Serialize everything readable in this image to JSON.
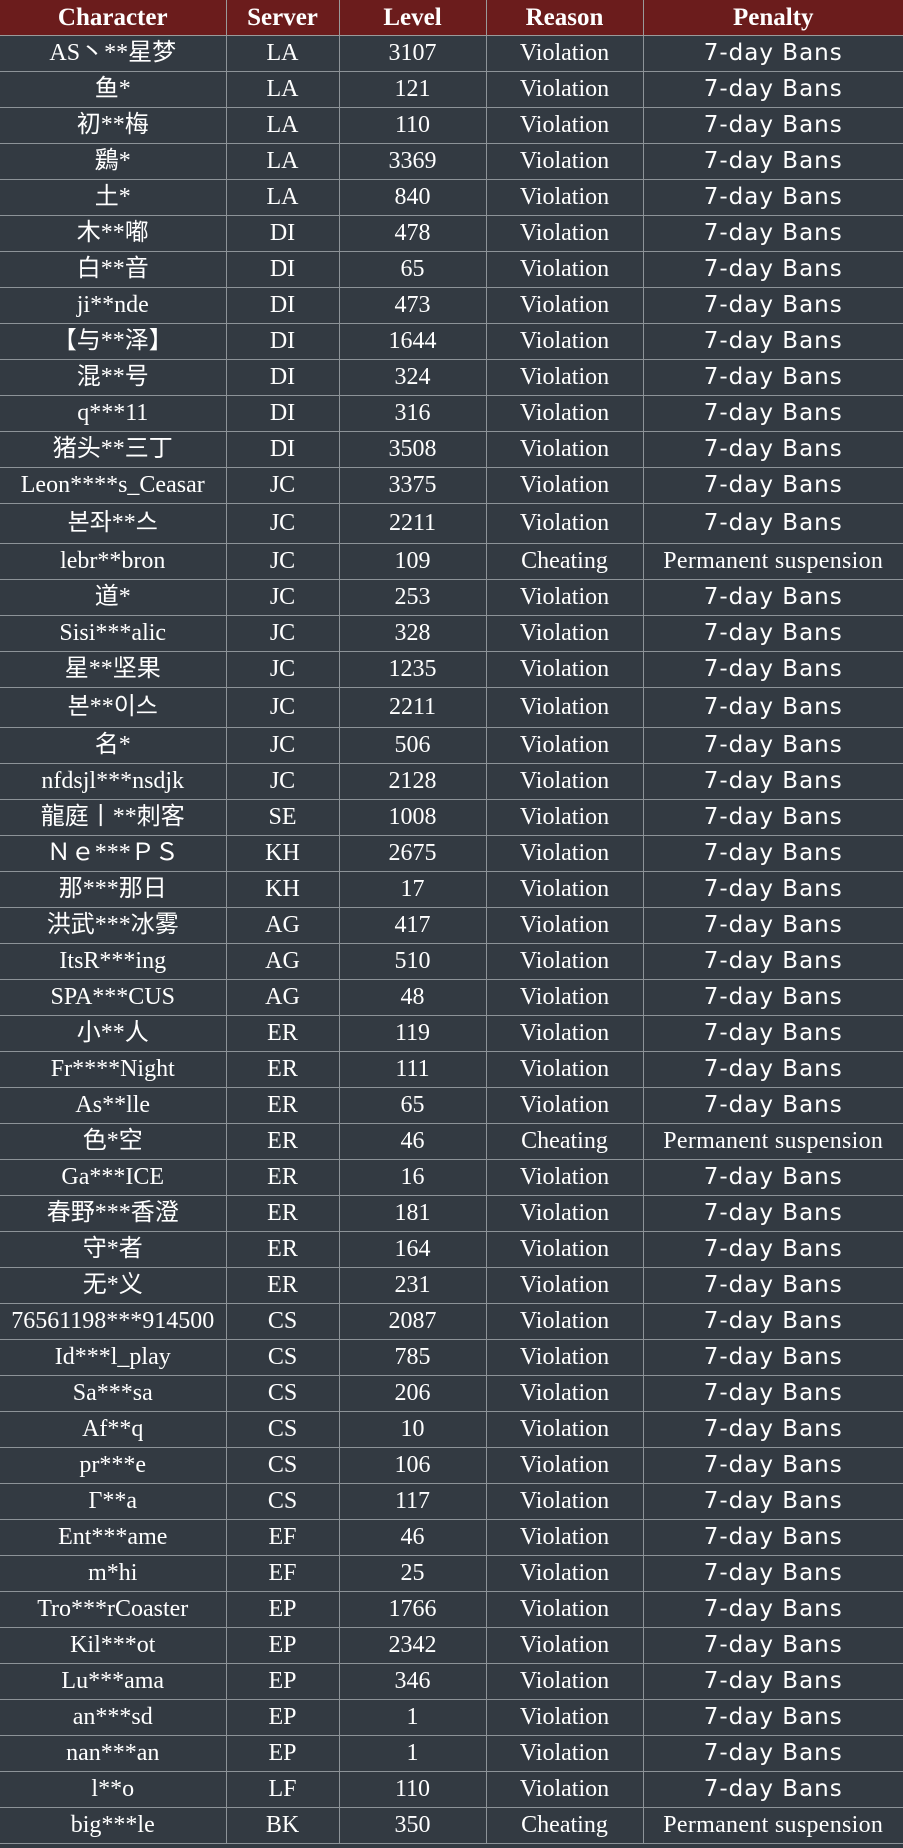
{
  "headers": {
    "character": "Character",
    "server": "Server",
    "level": "Level",
    "reason": "Reason",
    "penalty": "Penalty"
  },
  "rows": [
    {
      "character": "AS丶**星梦",
      "server": "LA",
      "level": "3107",
      "reason": "Violation",
      "penalty": "7-day Bans"
    },
    {
      "character": "鱼*",
      "server": "LA",
      "level": "121",
      "reason": "Violation",
      "penalty": "7-day Bans"
    },
    {
      "character": "初**梅",
      "server": "LA",
      "level": "110",
      "reason": "Violation",
      "penalty": "7-day Bans"
    },
    {
      "character": "鶢*",
      "server": "LA",
      "level": "3369",
      "reason": "Violation",
      "penalty": "7-day Bans"
    },
    {
      "character": "土*",
      "server": "LA",
      "level": "840",
      "reason": "Violation",
      "penalty": "7-day Bans"
    },
    {
      "character": "木**嘟",
      "server": "DI",
      "level": "478",
      "reason": "Violation",
      "penalty": "7-day Bans"
    },
    {
      "character": "白**音",
      "server": "DI",
      "level": "65",
      "reason": "Violation",
      "penalty": "7-day Bans"
    },
    {
      "character": "ji**nde",
      "server": "DI",
      "level": "473",
      "reason": "Violation",
      "penalty": "7-day Bans"
    },
    {
      "character": "【与**泽】",
      "server": "DI",
      "level": "1644",
      "reason": "Violation",
      "penalty": "7-day Bans"
    },
    {
      "character": "混**号",
      "server": "DI",
      "level": "324",
      "reason": "Violation",
      "penalty": "7-day Bans"
    },
    {
      "character": "q***11",
      "server": "DI",
      "level": "316",
      "reason": "Violation",
      "penalty": "7-day Bans"
    },
    {
      "character": "猪头**三丁",
      "server": "DI",
      "level": "3508",
      "reason": "Violation",
      "penalty": "7-day Bans"
    },
    {
      "character": "Leon****s_Ceasar",
      "server": "JC",
      "level": "3375",
      "reason": "Violation",
      "penalty": "7-day Bans"
    },
    {
      "character": "본좌**스",
      "server": "JC",
      "level": "2211",
      "reason": "Violation",
      "penalty": "7-day Bans"
    },
    {
      "character": "lebr**bron",
      "server": "JC",
      "level": "109",
      "reason": "Cheating",
      "penalty": "Permanent suspension"
    },
    {
      "character": "道*",
      "server": "JC",
      "level": "253",
      "reason": "Violation",
      "penalty": "7-day Bans"
    },
    {
      "character": "Sisi***alic",
      "server": "JC",
      "level": "328",
      "reason": "Violation",
      "penalty": "7-day Bans"
    },
    {
      "character": "星**坚果",
      "server": "JC",
      "level": "1235",
      "reason": "Violation",
      "penalty": "7-day Bans"
    },
    {
      "character": "본**이스",
      "server": "JC",
      "level": "2211",
      "reason": "Violation",
      "penalty": "7-day Bans"
    },
    {
      "character": "名*",
      "server": "JC",
      "level": "506",
      "reason": "Violation",
      "penalty": "7-day Bans"
    },
    {
      "character": "nfdsjl***nsdjk",
      "server": "JC",
      "level": "2128",
      "reason": "Violation",
      "penalty": "7-day Bans"
    },
    {
      "character": "龍庭丨**刺客",
      "server": "SE",
      "level": "1008",
      "reason": "Violation",
      "penalty": "7-day Bans"
    },
    {
      "character": "Ｎｅ***ＰＳ",
      "server": "KH",
      "level": "2675",
      "reason": "Violation",
      "penalty": "7-day Bans"
    },
    {
      "character": "那***那日",
      "server": "KH",
      "level": "17",
      "reason": "Violation",
      "penalty": "7-day Bans"
    },
    {
      "character": "洪武***冰雾",
      "server": "AG",
      "level": "417",
      "reason": "Violation",
      "penalty": "7-day Bans"
    },
    {
      "character": "ItsR***ing",
      "server": "AG",
      "level": "510",
      "reason": "Violation",
      "penalty": "7-day Bans"
    },
    {
      "character": "SPA***CUS",
      "server": "AG",
      "level": "48",
      "reason": "Violation",
      "penalty": "7-day Bans"
    },
    {
      "character": "小**人",
      "server": "ER",
      "level": "119",
      "reason": "Violation",
      "penalty": "7-day Bans"
    },
    {
      "character": "Fr****Night",
      "server": "ER",
      "level": "111",
      "reason": "Violation",
      "penalty": "7-day Bans"
    },
    {
      "character": "As**lle",
      "server": "ER",
      "level": "65",
      "reason": "Violation",
      "penalty": "7-day Bans"
    },
    {
      "character": "色*空",
      "server": "ER",
      "level": "46",
      "reason": "Cheating",
      "penalty": "Permanent suspension"
    },
    {
      "character": "Ga***ICE",
      "server": "ER",
      "level": "16",
      "reason": "Violation",
      "penalty": "7-day Bans"
    },
    {
      "character": "春野***香澄",
      "server": "ER",
      "level": "181",
      "reason": "Violation",
      "penalty": "7-day Bans"
    },
    {
      "character": "守*者",
      "server": "ER",
      "level": "164",
      "reason": "Violation",
      "penalty": "7-day Bans"
    },
    {
      "character": "无*义",
      "server": "ER",
      "level": "231",
      "reason": "Violation",
      "penalty": "7-day Bans"
    },
    {
      "character": "76561198***914500",
      "server": "CS",
      "level": "2087",
      "reason": "Violation",
      "penalty": "7-day Bans"
    },
    {
      "character": "Id***l_play",
      "server": "CS",
      "level": "785",
      "reason": "Violation",
      "penalty": "7-day Bans"
    },
    {
      "character": "Sa***sa",
      "server": "CS",
      "level": "206",
      "reason": "Violation",
      "penalty": "7-day Bans"
    },
    {
      "character": "Af**q",
      "server": "CS",
      "level": "10",
      "reason": "Violation",
      "penalty": "7-day Bans"
    },
    {
      "character": "pr***e",
      "server": "CS",
      "level": "106",
      "reason": "Violation",
      "penalty": "7-day Bans"
    },
    {
      "character": "Γ**a",
      "server": "CS",
      "level": "117",
      "reason": "Violation",
      "penalty": "7-day Bans"
    },
    {
      "character": "Ent***ame",
      "server": "EF",
      "level": "46",
      "reason": "Violation",
      "penalty": "7-day Bans"
    },
    {
      "character": "m*hi",
      "server": "EF",
      "level": "25",
      "reason": "Violation",
      "penalty": "7-day Bans"
    },
    {
      "character": "Tro***rCoaster",
      "server": "EP",
      "level": "1766",
      "reason": "Violation",
      "penalty": "7-day Bans"
    },
    {
      "character": "Kil***ot",
      "server": "EP",
      "level": "2342",
      "reason": "Violation",
      "penalty": "7-day Bans"
    },
    {
      "character": "Lu***ama",
      "server": "EP",
      "level": "346",
      "reason": "Violation",
      "penalty": "7-day Bans"
    },
    {
      "character": "an***sd",
      "server": "EP",
      "level": "1",
      "reason": "Violation",
      "penalty": "7-day Bans"
    },
    {
      "character": "nan***an",
      "server": "EP",
      "level": "1",
      "reason": "Violation",
      "penalty": "7-day Bans"
    },
    {
      "character": "l**o",
      "server": "LF",
      "level": "110",
      "reason": "Violation",
      "penalty": "7-day Bans"
    },
    {
      "character": "big***le",
      "server": "BK",
      "level": "350",
      "reason": "Cheating",
      "penalty": "Permanent suspension"
    }
  ]
}
